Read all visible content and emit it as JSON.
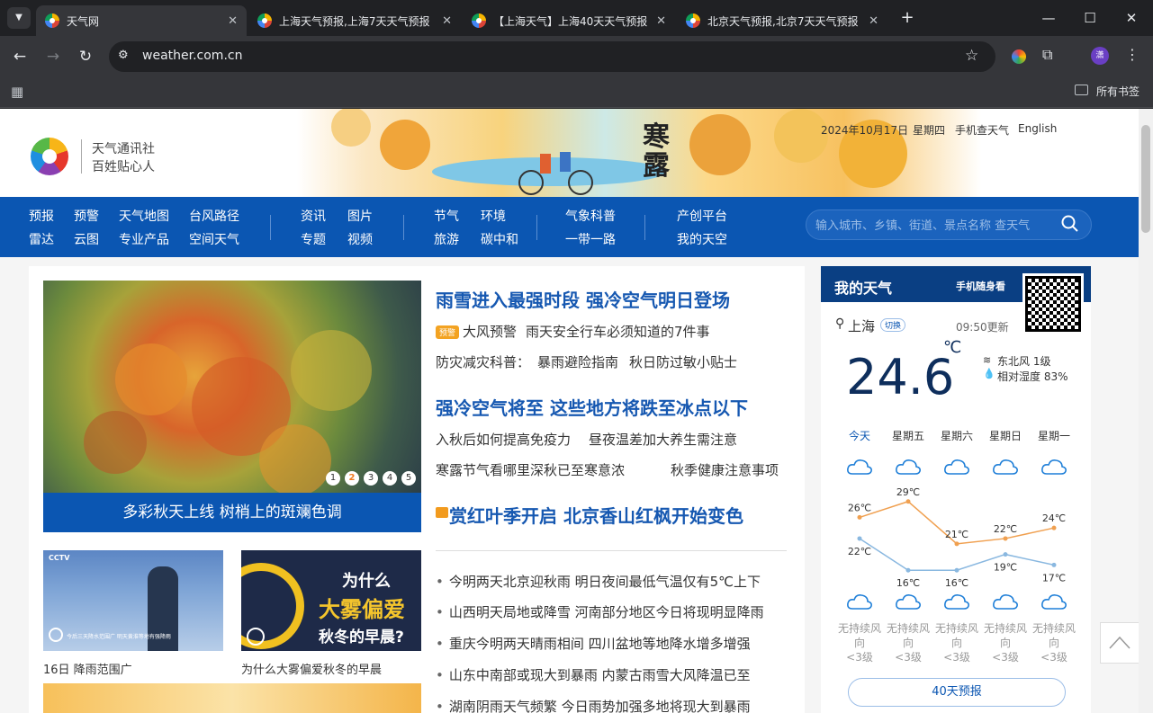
{
  "browser": {
    "tabs": [
      {
        "title": "天气网",
        "active": true
      },
      {
        "title": "上海天气预报,上海7天天气预报",
        "active": false
      },
      {
        "title": "【上海天气】上海40天天气预报",
        "active": false
      },
      {
        "title": "北京天气预报,北京7天天气预报",
        "active": false
      }
    ],
    "url": "weather.com.cn",
    "bookmarks_label": "所有书签",
    "profile_initial": "潇"
  },
  "header": {
    "slogan1": "天气通讯社",
    "slogan2": "百姓贴心人",
    "banner_text": "寒露",
    "date": "2024年10月17日",
    "weekday": "星期四",
    "mobile_link": "手机查天气",
    "english_link": "English"
  },
  "nav": {
    "g1_row1": [
      "预报",
      "预警",
      "天气地图",
      "台风路径"
    ],
    "g1_row2": [
      "雷达",
      "云图",
      "专业产品",
      "空间天气"
    ],
    "g2_row1": [
      "资讯",
      "图片"
    ],
    "g2_row2": [
      "专题",
      "视频"
    ],
    "g3_row1": [
      "节气",
      "环境"
    ],
    "g3_row2": [
      "旅游",
      "碳中和"
    ],
    "g4_row1": [
      "气象科普"
    ],
    "g4_row2": [
      "一带一路"
    ],
    "g5_row1": [
      "产创平台"
    ],
    "g5_row2": [
      "我的天空"
    ],
    "search_placeholder": "输入城市、乡镇、街道、景点名称 查天气"
  },
  "main": {
    "hero_caption": "多彩秋天上线 树梢上的斑斓色调",
    "pager": [
      "1",
      "2",
      "3",
      "4",
      "5"
    ],
    "thumb1_caption": "16日 降雨范围广",
    "thumb2_caption": "为什么大雾偏爱秋冬的早晨",
    "thumb1_screen_text": "今后三天降水范围广 明天黄淮等地有强降雨",
    "thumb1_corner": "CCTV",
    "thumb2_art": [
      "为什么",
      "大雾偏爱",
      "秋冬的早晨?"
    ],
    "headline1": "雨雪进入最强时段 强冷空气明日登场",
    "alert_badge": "预警",
    "sub1a": "大风预警",
    "sub1b": "雨天安全行车必须知道的7件事",
    "sub2a": "防灾减灾科普：",
    "sub2b": "暴雨避险指南",
    "sub2c": "秋日防过敏小贴士",
    "headline2": "强冷空气将至 这些地方将跌至冰点以下",
    "sub3a": "入秋后如何提高免疫力",
    "sub3b": "昼夜温差加大养生需注意",
    "sub4a": "寒露节气看哪里深秋已至寒意浓",
    "sub4b": "秋季健康注意事项",
    "headline3": "赏红叶季开启 北京香山红枫开始变色",
    "news": [
      "今明两天北京迎秋雨 明日夜间最低气温仅有5℃上下",
      "山西明天局地或降雪  河南部分地区今日将现明显降雨",
      "重庆今明两天晴雨相间  四川盆地等地降水增多增强",
      "山东中南部或现大到暴雨  内蒙古雨雪大风降温已至",
      "湖南阴雨天气频繁 今日雨势加强多地将现大到暴雨"
    ]
  },
  "weather": {
    "title": "我的天气",
    "mobile": "手机随身看",
    "city": "上海",
    "switch": "切换",
    "updated": "09:50更新",
    "temp": "24.6",
    "unit": "℃",
    "wind": "东北风 1级",
    "humidity": "相对湿度 83%",
    "days": [
      "今天",
      "星期五",
      "星期六",
      "星期日",
      "星期一"
    ],
    "highs": [
      "26℃",
      "29℃",
      "21℃",
      "22℃",
      "24℃"
    ],
    "lows": [
      "22℃",
      "16℃",
      "16℃",
      "19℃",
      "17℃"
    ],
    "wind_desc_line1": "无持续风",
    "wind_desc_line2": "向",
    "wind_desc_line3": "<3级",
    "forecast40": "40天预报",
    "colors": {
      "high_line": "#f0a050",
      "low_line": "#8ab8e0",
      "accent": "#0b56b2"
    }
  }
}
